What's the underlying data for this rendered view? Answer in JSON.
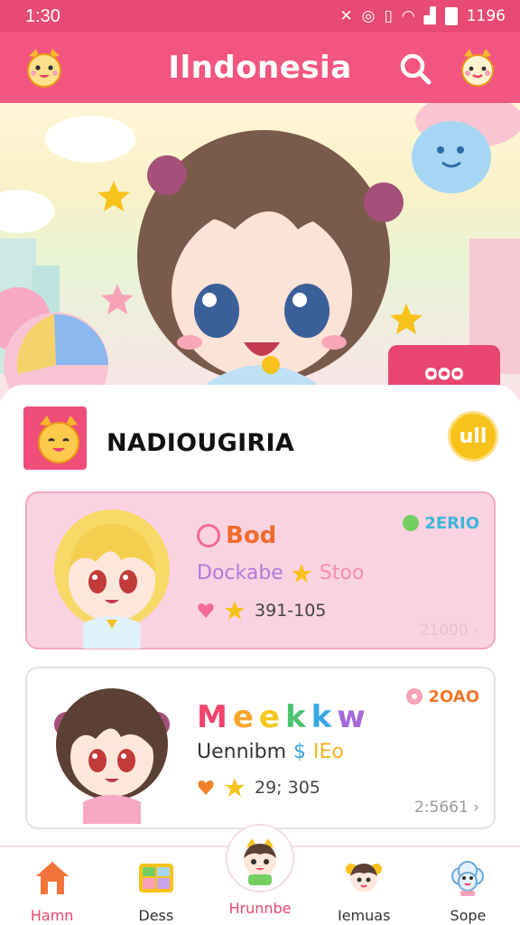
{
  "status": {
    "time": "1:30",
    "battery_text": "1196"
  },
  "app": {
    "title": "Ilndonesia"
  },
  "hero": {
    "button_label": "ᴑᴑᴑ"
  },
  "section": {
    "title": "NADIOUGIRIA",
    "badge": "ull"
  },
  "cards": [
    {
      "name": "Bod",
      "subtitle_left": "Dockabe",
      "subtitle_right": "Stoo",
      "stats": "391-105",
      "tag": "2ERIO",
      "footer": "21000 ›",
      "colors": {
        "name": "#f06b2d",
        "tag": "#3db6d8"
      }
    },
    {
      "name_letters": [
        "M",
        "e",
        "e",
        "k",
        "k",
        "w"
      ],
      "subtitle_left": "Uennibm",
      "subtitle_symbol": "$",
      "subtitle_right": "IEo",
      "stats": "29; 305",
      "tag": "2OAO",
      "footer": "2:5661 ›"
    }
  ],
  "nav": [
    {
      "label": "Hamn",
      "icon": "home-icon"
    },
    {
      "label": "Dess",
      "icon": "board-icon"
    },
    {
      "label": "Hrunnbe",
      "icon": "mascot-icon"
    },
    {
      "label": "Iemuas",
      "icon": "character-icon"
    },
    {
      "label": "Sope",
      "icon": "cloud-character-icon"
    }
  ],
  "colors": {
    "primary": "#f25680",
    "accent": "#e84570",
    "yellow": "#f7c31b",
    "card_pink": "#fad2e1"
  }
}
